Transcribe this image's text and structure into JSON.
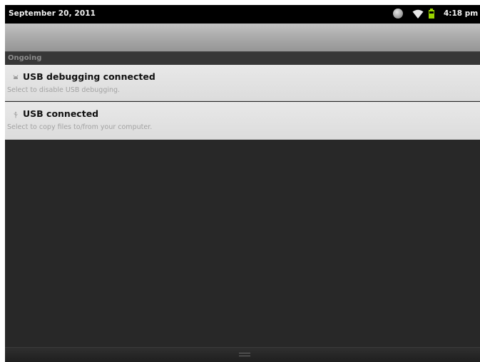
{
  "status_bar": {
    "date": "September 20, 2011",
    "time": "4:18 pm",
    "icons": [
      "globe-icon",
      "wifi-icon",
      "battery-icon"
    ],
    "battery_color": "#9ad400"
  },
  "notifications": {
    "section_label": "Ongoing",
    "items": [
      {
        "icon": "usb-debug-icon",
        "title": "USB debugging connected",
        "subtitle": "Select to disable USB debugging."
      },
      {
        "icon": "usb-icon",
        "title": "USB connected",
        "subtitle": "Select to copy files to/from your computer."
      }
    ]
  },
  "bottom_bar": {
    "handle_icon": "drag-handle-icon"
  }
}
